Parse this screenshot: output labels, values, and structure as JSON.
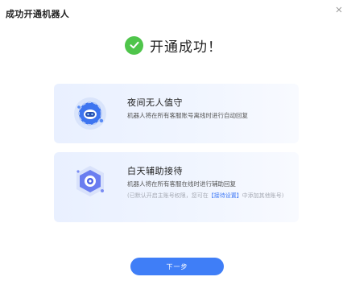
{
  "dialog": {
    "title": "成功开通机器人",
    "close_icon": "close-icon"
  },
  "success": {
    "icon": "check-circle-icon",
    "text": "开通成功！",
    "color": "#4fc54b"
  },
  "cards": [
    {
      "icon": "moon-robot-icon",
      "title": "夜间无人值守",
      "description": "机器人将在所有客服账号离线时进行自动回复"
    },
    {
      "icon": "daytime-assist-icon",
      "title": "白天辅助接待",
      "description": "机器人将在所有客服在线时进行辅助回复",
      "note_prefix": "(已默认开启主账号权限，您可在",
      "note_link": "【接待设置】",
      "note_suffix": "中添加其他账号)"
    }
  ],
  "next_button": {
    "label": "下一步",
    "color": "#3f7ef7"
  }
}
